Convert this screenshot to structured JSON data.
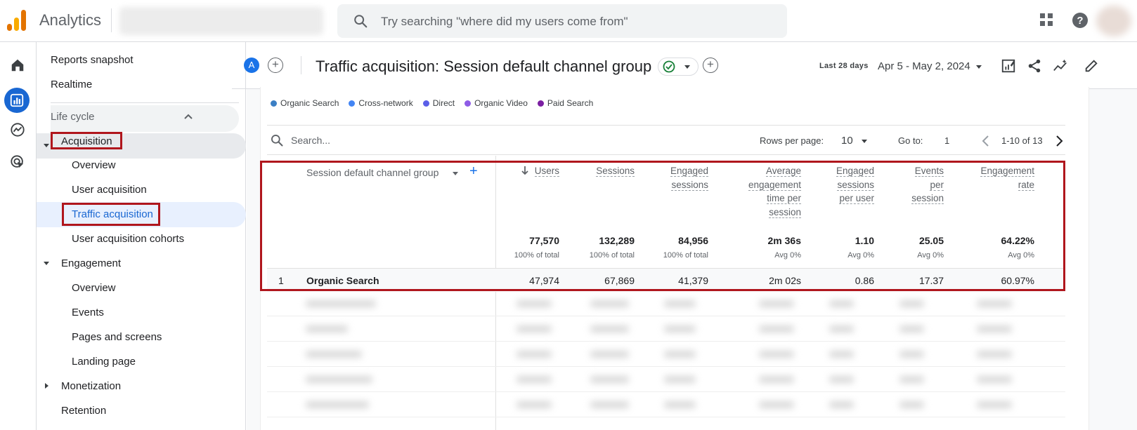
{
  "app": {
    "title": "Analytics"
  },
  "search": {
    "placeholder": "Try searching \"where did my users come from\""
  },
  "nav": {
    "items": {
      "reports_snapshot": "Reports snapshot",
      "realtime": "Realtime",
      "life_cycle": "Life cycle",
      "acquisition": "Acquisition",
      "acq_overview": "Overview",
      "user_acquisition": "User acquisition",
      "traffic_acquisition": "Traffic acquisition",
      "user_acquisition_cohorts": "User acquisition cohorts",
      "engagement": "Engagement",
      "eng_overview": "Overview",
      "events": "Events",
      "pages_and_screens": "Pages and screens",
      "landing_page": "Landing page",
      "monetization": "Monetization",
      "retention": "Retention"
    }
  },
  "report": {
    "comparison_badge": "A",
    "title": "Traffic acquisition: Session default channel group",
    "date_label": "Last 28 days",
    "date_range": "Apr 5 - May 2, 2024"
  },
  "legend": [
    {
      "label": "Organic Search",
      "color": "#3b7fc4"
    },
    {
      "label": "Cross-network",
      "color": "#4285f4"
    },
    {
      "label": "Direct",
      "color": "#5b5fe8"
    },
    {
      "label": "Organic Video",
      "color": "#8e5ce6"
    },
    {
      "label": "Paid Search",
      "color": "#7b1fa2"
    }
  ],
  "table_controls": {
    "search_placeholder": "Search...",
    "rows_per_page_label": "Rows per page:",
    "rows_per_page_value": "10",
    "go_to_label": "Go to:",
    "go_to_value": "1",
    "page_range": "1-10 of 13"
  },
  "table": {
    "dimension_header": "Session default channel group",
    "columns": [
      {
        "label": [
          "Users"
        ],
        "total": "77,570",
        "sub": "100% of total"
      },
      {
        "label": [
          "Sessions"
        ],
        "total": "132,289",
        "sub": "100% of total"
      },
      {
        "label": [
          "Engaged",
          "sessions"
        ],
        "total": "84,956",
        "sub": "100% of total"
      },
      {
        "label": [
          "Average",
          "engagement",
          "time per",
          "session"
        ],
        "total": "2m 36s",
        "sub": "Avg 0%"
      },
      {
        "label": [
          "Engaged",
          "sessions",
          "per user"
        ],
        "total": "1.10",
        "sub": "Avg 0%"
      },
      {
        "label": [
          "Events",
          "per",
          "session"
        ],
        "total": "25.05",
        "sub": "Avg 0%"
      },
      {
        "label": [
          "Engagement",
          "rate"
        ],
        "total": "64.22%",
        "sub": "Avg 0%"
      }
    ],
    "rows": [
      {
        "index": "1",
        "channel": "Organic Search",
        "values": [
          "47,974",
          "67,869",
          "41,379",
          "2m 02s",
          "0.86",
          "17.37",
          "60.97%"
        ]
      }
    ]
  }
}
